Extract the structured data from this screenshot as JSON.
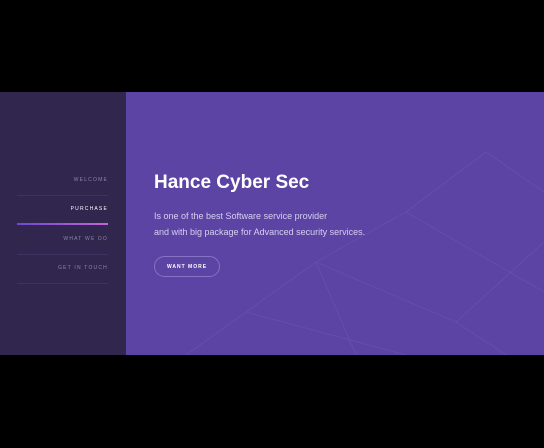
{
  "nav": {
    "items": [
      {
        "label": "WELCOME"
      },
      {
        "label": "PURCHASE"
      },
      {
        "label": "WHAT WE DO"
      },
      {
        "label": "GET IN TOUCH"
      }
    ],
    "active_index": 1
  },
  "hero": {
    "title": "Hance Cyber Sec",
    "description_line1": "Is one of the best Software service provider",
    "description_line2": "and with big package for Advanced security services.",
    "cta_label": "WANT MORE"
  },
  "colors": {
    "sidebar_bg": "#30264e",
    "main_bg": "#5c44a5",
    "accent_gradient_start": "#6d4ad3",
    "accent_gradient_end": "#c564d9",
    "page_bg": "#000000"
  }
}
